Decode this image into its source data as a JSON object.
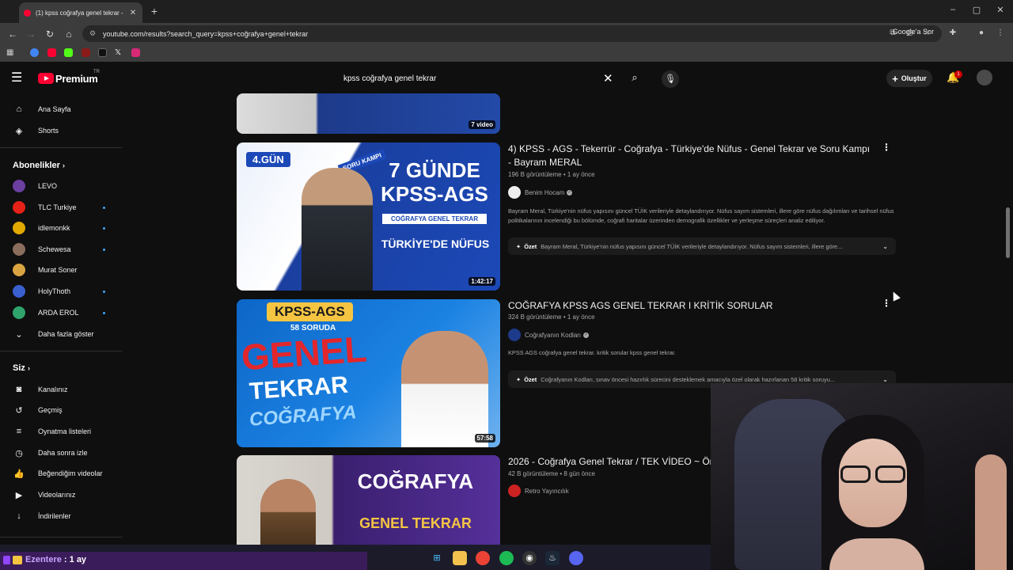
{
  "browser": {
    "tab_title": "(1) kpss coğrafya genel tekrar -",
    "url": "youtube.com/results?search_query=kpss+coğrafya+genel+tekrar",
    "google_ask": "Google'a Sor"
  },
  "masthead": {
    "logo_text": "Premium",
    "country": "TR",
    "search_value": "kpss coğrafya genel tekrar",
    "create_label": "Oluştur",
    "notification_count": "1"
  },
  "sidebar": {
    "home": "Ana Sayfa",
    "shorts": "Shorts",
    "subscriptions_title": "Abonelikler",
    "channels": [
      {
        "name": "LEVO",
        "color": "#6b3fa0",
        "new": false
      },
      {
        "name": "TLC Turkiye",
        "color": "#e62117",
        "new": true
      },
      {
        "name": "idlemonkk",
        "color": "#e0a800",
        "new": true
      },
      {
        "name": "Schewesa",
        "color": "#8a6d5c",
        "new": true
      },
      {
        "name": "Murat Soner",
        "color": "#d9a441",
        "new": false
      },
      {
        "name": "HolyThoth",
        "color": "#3a5fcf",
        "new": true
      },
      {
        "name": "ARDA EROL",
        "color": "#2fa36b",
        "new": true
      }
    ],
    "show_more": "Daha fazla göster",
    "you_title": "Siz",
    "you_items": [
      "Kanalınız",
      "Geçmiş",
      "Oynatma listeleri",
      "Daha sonra izle",
      "Beğendiğim videolar",
      "Videolarınız",
      "İndirilenler"
    ]
  },
  "results": [
    {
      "duration": "7 video",
      "title": "",
      "meta": "",
      "channel": "",
      "description": "",
      "summary": ""
    },
    {
      "duration": "1:42:17",
      "title": "4) KPSS - AGS - Tekerrür - Coğrafya - Türkiye'de Nüfus - Genel Tekrar ve Soru Kampı - Bayram MERAL",
      "meta": "196 B görüntüleme • 1 ay önce",
      "channel": "Benim Hocam",
      "description": "Bayram Meral, Türkiye'nin nüfus yapısını güncel TÜİK verileriyle detaylandırıyor. Nüfus sayım sistemleri, illere göre nüfus dağılımları ve tarihsel nüfus politikalarının incelendiği bu bölümde, coğrafi haritalar üzerinden demografik özellikler ve yerleşme süreçleri analiz ediliyor.",
      "summary_label": "Özet",
      "summary": "Bayram Meral, Türkiye'nin nüfus yapısını güncel TÜİK verileriyle detaylandırıyor. Nüfus sayım sistemleri, illere göre...",
      "thumb": {
        "badge": "4.GÜN",
        "big1": "7 GÜNDE",
        "big2": "KPSS-AGS",
        "sub": "COĞRAFYA GENEL TEKRAR",
        "topic": "TÜRKİYE'DE NÜFUS",
        "tag": "SORU KAMPI"
      }
    },
    {
      "duration": "57:58",
      "title": "COĞRAFYA KPSS AGS GENEL TEKRAR I KRİTİK SORULAR",
      "meta": "324 B görüntüleme • 1 ay önce",
      "channel": "Coğrafyanın Kodları",
      "description": "KPSS AGS coğrafya genel tekrar. kritik sorular kpss genel tekrar.",
      "summary_label": "Özet",
      "summary": "Coğrafyanın Kodları, sınav öncesi hazırlık sürecini desteklemek amacıyla özel olarak hazırlanan 58 kritik soruyu...",
      "thumb": {
        "top": "KPSS-AGS",
        "sub": "58 SORUDA",
        "big1": "GENEL",
        "big2": "TEKRAR",
        "big3": "COĞRAFYA"
      }
    },
    {
      "duration": "",
      "title": "2026 - Coğrafya Genel Tekrar / TEK VİDEO ~ Öna",
      "meta": "42 B görüntüleme • 8 gün önce",
      "channel": "Retro Yayıncılık",
      "thumb": {
        "big1": "COĞRAFYA",
        "big2": "GENEL TEKRAR"
      }
    }
  ],
  "stream": {
    "user": "Ezentere",
    "duration": ": 1 ay"
  },
  "colors": {
    "accent": "#ff0033",
    "link": "#3ea6ff",
    "bg": "#0f0f0f"
  }
}
